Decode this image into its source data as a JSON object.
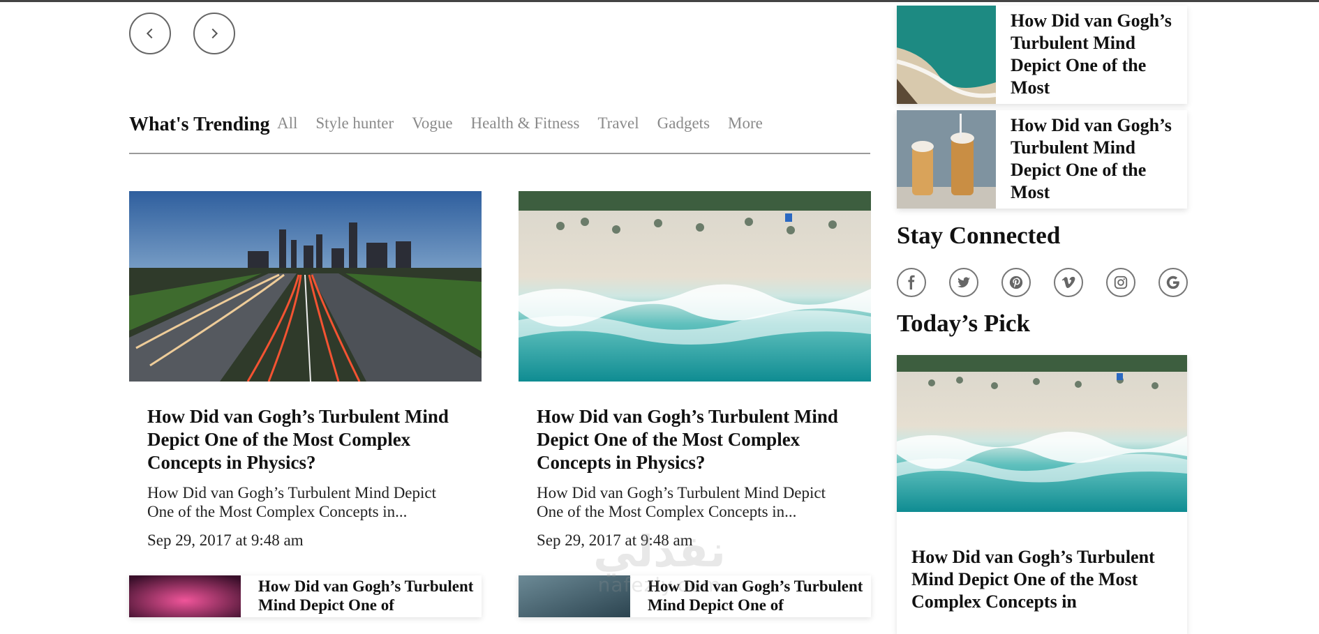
{
  "trending": {
    "title": "What's Trending",
    "tabs": [
      "All",
      "Style hunter",
      "Vogue",
      "Health & Fitness",
      "Travel",
      "Gadgets",
      "More"
    ]
  },
  "cards": [
    {
      "title": "How Did van Gogh’s Turbulent Mind Depict One of the Most Complex Concepts in Physics?",
      "excerpt": "How Did van Gogh’s Turbulent Mind Depict One of the Most Complex Concepts in...",
      "date": "Sep 29, 2017 at 9:48 am",
      "image": "city-highway-night-photo"
    },
    {
      "title": "How Did van Gogh’s Turbulent Mind Depict One of the Most Complex Concepts in Physics?",
      "excerpt": "How Did van Gogh’s Turbulent Mind Depict One of the Most Complex Concepts in...",
      "date": "Sep 29, 2017 at 9:48 am",
      "image": "aerial-beach-photo"
    }
  ],
  "mini_cards": [
    {
      "title": "How Did van Gogh’s Turbulent Mind Depict One of",
      "image": "pink-abstract-photo"
    },
    {
      "title": "How Did van Gogh’s Turbulent Mind Depict One of",
      "image": "blue-abstract-photo"
    }
  ],
  "sidebar": {
    "items": [
      {
        "title": "How Did van Gogh’s Turbulent Mind Depict One of the Most",
        "image": "aerial-coast-photo"
      },
      {
        "title": "How Did van Gogh’s Turbulent Mind Depict One of the Most",
        "image": "iced-drinks-photo"
      }
    ],
    "stay_connected": "Stay Connected",
    "social_icons": [
      "facebook-icon",
      "twitter-icon",
      "pinterest-icon",
      "vimeo-icon",
      "instagram-icon",
      "google-icon"
    ],
    "todays_pick": "Today’s Pick",
    "pick": {
      "title": "How Did van Gogh’s Turbulent Mind Depict One of the Most Complex Concepts in",
      "image": "aerial-beach-photo"
    }
  },
  "watermark": {
    "arabic": "نفذلي",
    "latin": "nafezly.com"
  },
  "colors": {
    "accent_text": "#111111",
    "muted_tab": "#8a8a8a",
    "rule": "#9a9a9a"
  }
}
